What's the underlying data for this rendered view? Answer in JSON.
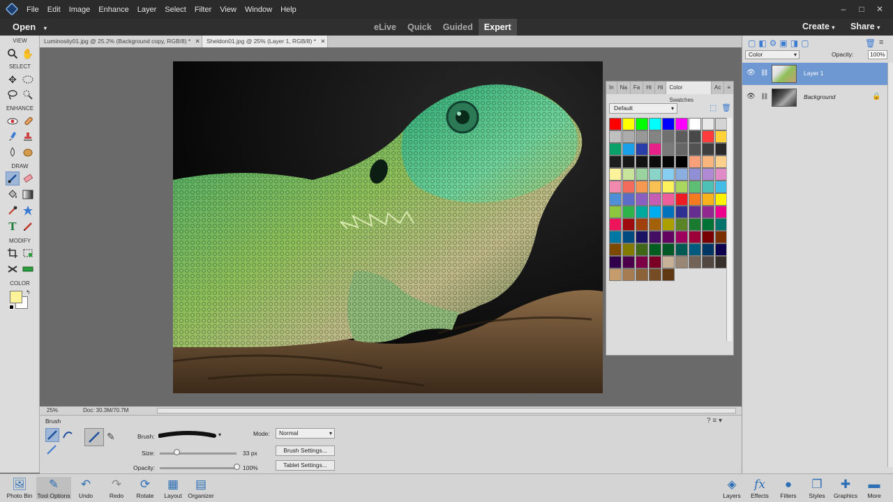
{
  "menubar": {
    "items": [
      "File",
      "Edit",
      "Image",
      "Enhance",
      "Layer",
      "Select",
      "Filter",
      "View",
      "Window",
      "Help"
    ],
    "window_controls": [
      "–",
      "□",
      "✕"
    ]
  },
  "modebar": {
    "open_label": "Open",
    "modes": [
      "eLive",
      "Quick",
      "Guided",
      "Expert"
    ],
    "active_mode": "Expert",
    "create_label": "Create",
    "share_label": "Share"
  },
  "toolbar": {
    "sections": [
      "VIEW",
      "SELECT",
      "ENHANCE",
      "DRAW",
      "MODIFY",
      "COLOR"
    ],
    "foreground_color": "#fdf39a",
    "background_color": "#ffffff"
  },
  "tabs": [
    {
      "label": "Luminosity01.jpg @ 25.2% (Background copy, RGB/8) *"
    },
    {
      "label": "Sheldon01.jpg @ 25% (Layer 1, RGB/8) *"
    }
  ],
  "status": {
    "zoom": "25%",
    "doc": "Doc: 30.3M/70.7M"
  },
  "swatches_panel": {
    "tabs": [
      "In",
      "Na",
      "Fa",
      "Hi",
      "Hi",
      "Color Swatches",
      "Ac"
    ],
    "active_tab": "Color Swatches",
    "preset": "Default",
    "colors": [
      "#ff0000",
      "#ffff00",
      "#00ff00",
      "#00ffff",
      "#0000ff",
      "#ff00ff",
      "#ffffff",
      "#e8e8e8",
      "#d4d4d4",
      "#c0c0c0",
      "#acacac",
      "#989898",
      "#848484",
      "#707070",
      "#5c5c5c",
      "#484848",
      "#ff3b3b",
      "#ffd23a",
      "#0aa06a",
      "#1aa0e8",
      "#2a3ea8",
      "#e8208a",
      "#7a7a7a",
      "#666666",
      "#525252",
      "#3e3e3e",
      "#2a2a2a",
      "#1e1e1e",
      "#181818",
      "#121212",
      "#0c0c0c",
      "#060606",
      "#000000",
      "#f7a07a",
      "#f9b57e",
      "#fbd08a",
      "#fdf39a",
      "#c8e39a",
      "#9ad2a0",
      "#8ad4c8",
      "#86cff0",
      "#8aaee0",
      "#908ed4",
      "#b08ad2",
      "#e08ac6",
      "#f28ab0",
      "#f26b5c",
      "#f49852",
      "#f9c052",
      "#fdf15e",
      "#a8d65e",
      "#5ebf74",
      "#4ec1b4",
      "#43bde6",
      "#4e8fd8",
      "#5b6dc6",
      "#8b5ec2",
      "#c65eb4",
      "#ee5e9a",
      "#ee1c24",
      "#f47b20",
      "#f8b31c",
      "#fff200",
      "#8dc63f",
      "#2eb34b",
      "#00a99d",
      "#00aeef",
      "#0072bc",
      "#2e3192",
      "#662d91",
      "#92278f",
      "#ec008c",
      "#ed145b",
      "#9e0b0f",
      "#a0410d",
      "#a36209",
      "#aba000",
      "#598527",
      "#1a7b30",
      "#007236",
      "#00746b",
      "#0076a3",
      "#004b80",
      "#1b1464",
      "#440e62",
      "#630460",
      "#9e005d",
      "#9e0039",
      "#790000",
      "#7b2e00",
      "#7d4900",
      "#827b00",
      "#406618",
      "#005e20",
      "#005826",
      "#005952",
      "#005b7f",
      "#003663",
      "#0d004c",
      "#32004b",
      "#4b0049",
      "#7b0046",
      "#7a0026",
      "#c7b299",
      "#998675",
      "#736357",
      "#534741",
      "#37302a",
      "#c69c6d",
      "#a67c52",
      "#8c6239",
      "#754c24",
      "#603913"
    ]
  },
  "options": {
    "tool_name": "Brush",
    "brush_label": "Brush:",
    "mode_label": "Mode:",
    "mode_value": "Normal",
    "size_label": "Size:",
    "size_value": "33 px",
    "size_fraction": 0.22,
    "opacity_label": "Opacity:",
    "opacity_value": "100%",
    "opacity_fraction": 1.0,
    "brush_settings": "Brush Settings...",
    "tablet_settings": "Tablet Settings..."
  },
  "bottom_left": [
    {
      "label": "Photo Bin",
      "icon": "photo-bin-icon"
    },
    {
      "label": "Tool Options",
      "icon": "tool-options-icon"
    },
    {
      "label": "Undo",
      "icon": "undo-icon"
    },
    {
      "label": "Redo",
      "icon": "redo-icon"
    },
    {
      "label": "Rotate",
      "icon": "rotate-icon"
    },
    {
      "label": "Layout",
      "icon": "layout-icon"
    },
    {
      "label": "Organizer",
      "icon": "organizer-icon"
    }
  ],
  "bottom_right": [
    {
      "label": "Layers",
      "icon": "layers-icon"
    },
    {
      "label": "Effects",
      "icon": "fx-icon"
    },
    {
      "label": "Filters",
      "icon": "filters-icon"
    },
    {
      "label": "Styles",
      "icon": "styles-icon"
    },
    {
      "label": "Graphics",
      "icon": "graphics-icon"
    },
    {
      "label": "More",
      "icon": "more-icon"
    }
  ],
  "layers_panel": {
    "blend_mode": "Color",
    "opacity_label": "Opacity:",
    "opacity_value": "100%",
    "layers": [
      {
        "name": "Layer 1",
        "selected": true
      },
      {
        "name": "Background",
        "selected": false
      }
    ]
  }
}
